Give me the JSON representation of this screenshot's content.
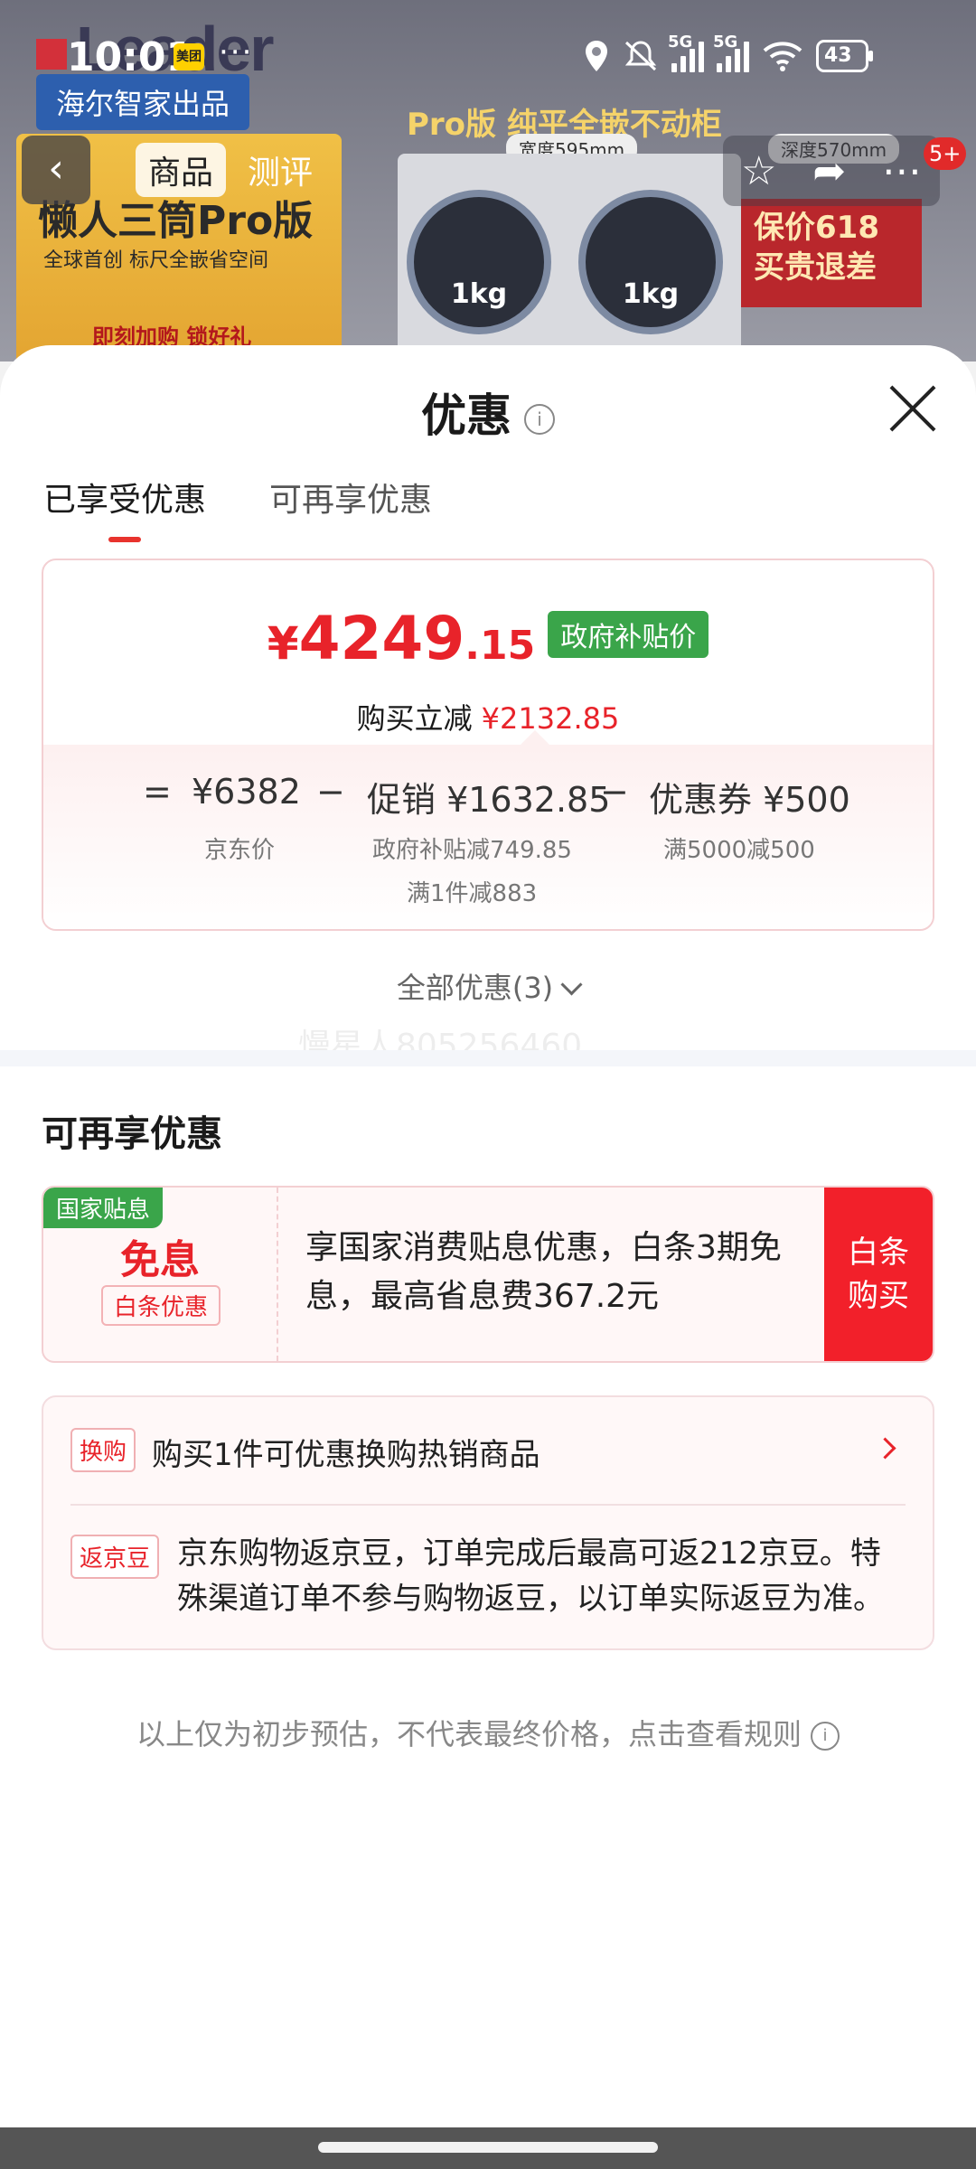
{
  "status_bar": {
    "time": "10:01",
    "meituan_badge": "美团",
    "more": "···",
    "signal_1": "5G",
    "signal_2": "5G",
    "battery": "43"
  },
  "background_page": {
    "brand": "Leader",
    "maker": "海尔智家出品",
    "promo_title": "懒人三筒Pro版",
    "promo_subtitle": "全球首创 标尺全嵌省空间",
    "promo_cta": "即刻加购 锁好礼",
    "pro_title": "Pro版 纯平全嵌不动柜",
    "width_tag": "宽度595mm",
    "depth_tag": "深度570mm",
    "drum_left": "1kg",
    "drum_right": "1kg",
    "red_badge": "保价618 买贵退差"
  },
  "top_nav": {
    "back": "‹",
    "tabs": [
      "商品",
      "测评"
    ],
    "active_tab": "商品",
    "notif_count": "5+",
    "icons": [
      "star-icon",
      "share-icon",
      "more-icon"
    ]
  },
  "sheet": {
    "title": "优惠",
    "info_glyph": "i",
    "tabs": [
      "已享受优惠",
      "可再享优惠"
    ],
    "price": {
      "yen": "¥",
      "integer": "4249",
      "decimal": ".15",
      "tag": "政府补贴价",
      "reduce_label": "购买立减",
      "reduce_value": "¥2132.85"
    },
    "breakdown": {
      "eq": "=",
      "jd_price": "¥6382",
      "jd_label": "京东价",
      "minus1": "−",
      "promo": "促销 ¥1632.85",
      "promo_sub1": "政府补贴减749.85",
      "promo_sub2": "满1件减883",
      "minus2": "−",
      "coupon": "优惠券 ¥500",
      "coupon_sub": "满5000减500"
    },
    "all_offers": "全部优惠(3)",
    "watermark": "慢星人805256460",
    "more_section_title": "可再享优惠",
    "baitiao": {
      "badge": "国家贴息",
      "free": "免息",
      "sub": "白条优惠",
      "desc": "享国家消费贴息优惠，白条3期免息，最高省息费367.2元",
      "button_line1": "白条",
      "button_line2": "购买"
    },
    "exchange": {
      "tag": "换购",
      "text": "购买1件可优惠换购热销商品"
    },
    "jingdou": {
      "tag": "返京豆",
      "text": "京东购物返京豆，订单完成后最高可返212京豆。特殊渠道订单不参与购物返豆，以订单实际返豆为准。"
    },
    "disclaimer": "以上仅为初步预估，不代表最终价格，点击查看规则"
  },
  "colors": {
    "accent_red": "#e8232a",
    "gov_green": "#3aa54a",
    "button_red": "#f2202a"
  }
}
